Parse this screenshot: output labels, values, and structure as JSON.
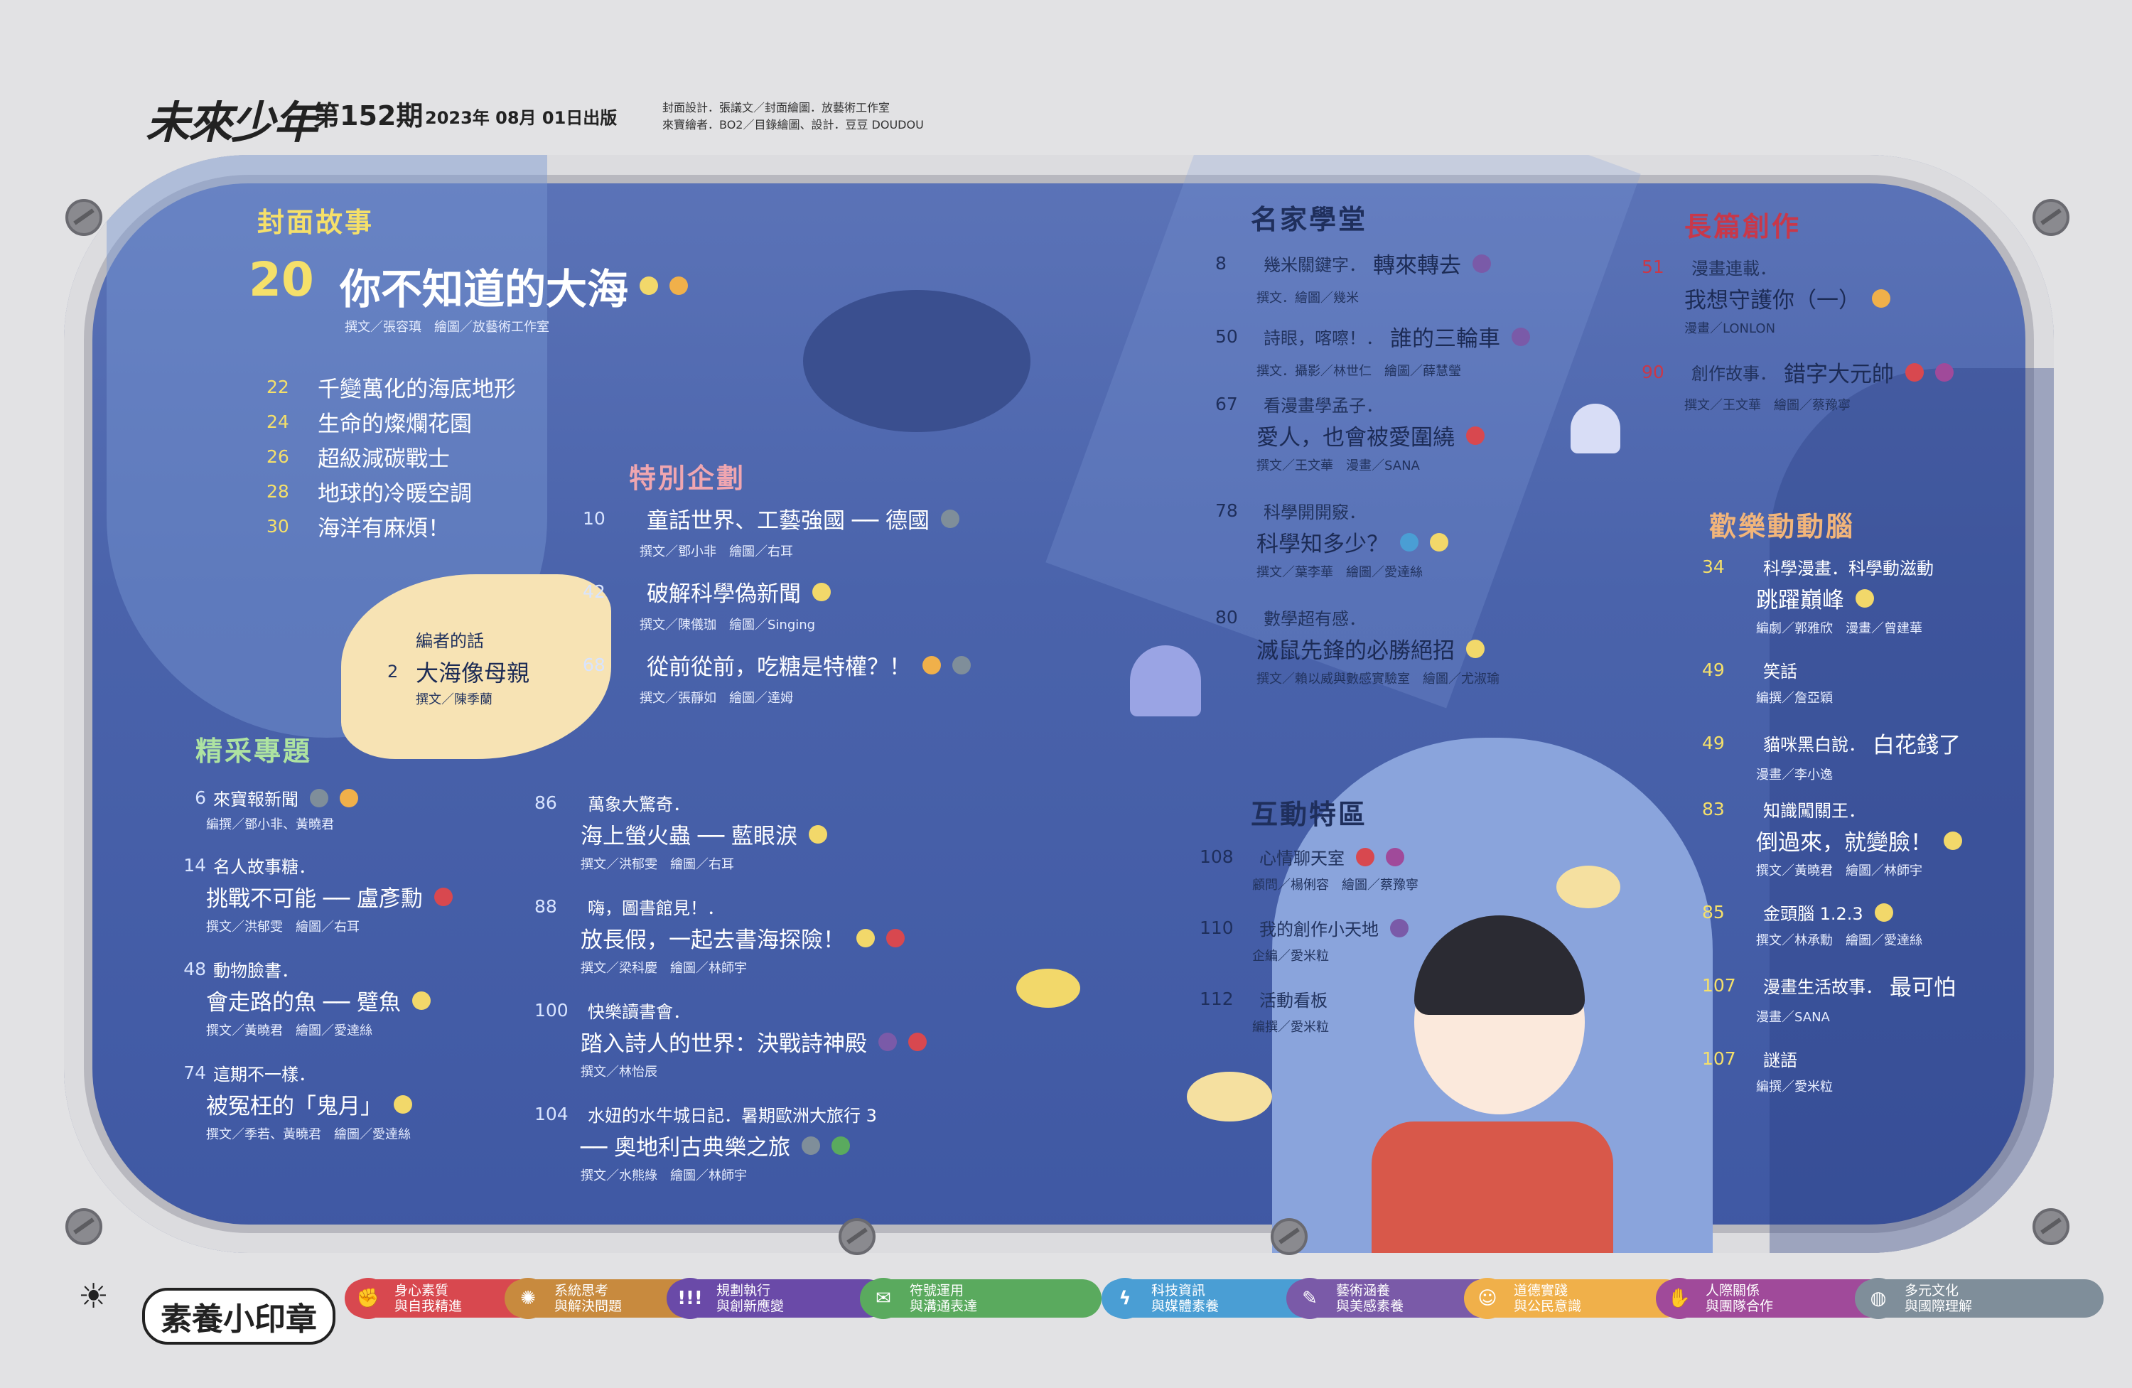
{
  "header": {
    "logo": "未來少年",
    "issue": "第152期",
    "date": "2023年 08月 01日出版",
    "credit_line1": "封面設計．張議文／封面繪圖．放藝術工作室",
    "credit_line2": "來寶繪者．BO2／目錄繪圖、設計．豆豆 DOUDOU"
  },
  "cover_story": {
    "title": "封面故事",
    "main_num": "20",
    "main_title": "你不知道的大海",
    "main_credit": "撰文／張容瑱　繪圖／放藝術工作室",
    "items": [
      {
        "num": "22",
        "title": "千變萬化的海底地形"
      },
      {
        "num": "24",
        "title": "生命的燦爛花園"
      },
      {
        "num": "26",
        "title": "超級減碳戰士"
      },
      {
        "num": "28",
        "title": "地球的冷暖空調"
      },
      {
        "num": "30",
        "title": "海洋有麻煩！"
      }
    ]
  },
  "editor": {
    "label": "編者的話",
    "num": "2",
    "title": "大海像母親",
    "credit": "撰文／陳季蘭"
  },
  "special": {
    "title": "特別企劃",
    "items": [
      {
        "num": "10",
        "title": "童話世界、工藝強國 ── 德國",
        "credit": "撰文／鄧小非　繪圖／右耳"
      },
      {
        "num": "42",
        "title": "破解科學偽新聞",
        "credit": "撰文／陳儀珈　繪圖／Singing"
      },
      {
        "num": "68",
        "title": "從前從前，吃糖是特權？！",
        "credit": "撰文／張靜如　繪圖／達姆"
      }
    ]
  },
  "featured": {
    "title": "精采專題",
    "items": [
      {
        "num": "6",
        "cat": "來寶報新聞",
        "title": "",
        "credit": "編撰／鄧小非、黃曉君"
      },
      {
        "num": "14",
        "cat": "名人故事糖．",
        "title": "挑戰不可能 ── 盧彥勳",
        "credit": "撰文／洪郁雯　繪圖／右耳"
      },
      {
        "num": "48",
        "cat": "動物臉書．",
        "title": "會走路的魚 ── 躄魚",
        "credit": "撰文／黃曉君　繪圖／愛達絲"
      },
      {
        "num": "74",
        "cat": "這期不一樣．",
        "title": "被冤枉的「鬼月」",
        "credit": "撰文／季若、黃曉君　繪圖／愛達絲"
      }
    ]
  },
  "middle": {
    "items": [
      {
        "num": "86",
        "cat": "萬象大驚奇．",
        "title": "海上螢火蟲 ── 藍眼淚",
        "credit": "撰文／洪郁雯　繪圖／右耳"
      },
      {
        "num": "88",
        "cat": "嗨，圖書館見！．",
        "title": "放長假，一起去書海探險！",
        "credit": "撰文／梁科慶　繪圖／林師宇"
      },
      {
        "num": "100",
        "cat": "快樂讀書會．",
        "title": "踏入詩人的世界：決戰詩神殿",
        "credit": "撰文／林怡辰"
      },
      {
        "num": "104",
        "cat": "水妞的水牛城日記．暑期歐洲大旅行 3",
        "title": "── 奧地利古典樂之旅",
        "credit": "撰文／水熊綠　繪圖／林師宇"
      }
    ]
  },
  "famous": {
    "title": "名家學堂",
    "items": [
      {
        "num": "8",
        "cat": "幾米關鍵字．",
        "title": "轉來轉去",
        "credit": "撰文．繪圖／幾米"
      },
      {
        "num": "50",
        "cat": "詩眼，喀嚓！．",
        "title": "誰的三輪車",
        "credit": "撰文．攝影／林世仁　繪圖／薛慧瑩"
      },
      {
        "num": "67",
        "cat": "看漫畫學孟子．",
        "title": "愛人，也會被愛圍繞",
        "credit": "撰文／王文華　漫畫／SANA"
      },
      {
        "num": "78",
        "cat": "科學開開竅．",
        "title": "科學知多少？",
        "credit": "撰文／葉李華　繪圖／愛達絲"
      },
      {
        "num": "80",
        "cat": "數學超有感．",
        "title": "滅鼠先鋒的必勝絕招",
        "credit": "撰文／賴以威與數感實驗室　繪圖／尤淑瑜"
      }
    ]
  },
  "interactive": {
    "title": "互動特區",
    "items": [
      {
        "num": "108",
        "title": "心情聊天室",
        "credit": "顧問／楊俐容　繪圖／蔡豫寧"
      },
      {
        "num": "110",
        "title": "我的創作小天地",
        "credit": "企編／愛米粒"
      },
      {
        "num": "112",
        "title": "活動看板",
        "credit": "編撰／愛米粒"
      }
    ]
  },
  "longform": {
    "title": "長篇創作",
    "items": [
      {
        "num": "51",
        "cat": "漫畫連載．",
        "title": "我想守護你（一）",
        "credit": "漫畫／LONLON"
      },
      {
        "num": "90",
        "cat": "創作故事．",
        "title": "錯字大元帥",
        "credit": "撰文／王文華　繪圖／蔡豫寧"
      }
    ]
  },
  "fun": {
    "title": "歡樂動動腦",
    "items": [
      {
        "num": "34",
        "cat": "科學漫畫．科學動滋動",
        "title": "跳躍巔峰",
        "credit": "編劇／郭雅欣　漫畫／曾建華"
      },
      {
        "num": "49",
        "cat": "笑話",
        "title": "",
        "credit": "編撰／詹亞穎"
      },
      {
        "num": "49",
        "cat": "貓咪黑白說．",
        "title": "白花錢了",
        "credit": "漫畫／李小逸"
      },
      {
        "num": "83",
        "cat": "知識闖關王．",
        "title": "倒過來，就變臉！",
        "credit": "撰文／黃曉君　繪圖／林師宇"
      },
      {
        "num": "85",
        "cat": "金頭腦 1.2.3",
        "title": "",
        "credit": "撰文／林承勳　繪圖／愛達絲"
      },
      {
        "num": "107",
        "cat": "漫畫生活故事．",
        "title": "最可怕",
        "credit": "漫畫／SANA"
      },
      {
        "num": "107",
        "cat": "謎語",
        "title": "",
        "credit": "編撰／愛米粒"
      }
    ]
  },
  "legend": {
    "title": "素養小印章",
    "items": [
      {
        "l1": "身心素質",
        "l2": "與自我精進",
        "color": "#d8484f",
        "glyph": "✊"
      },
      {
        "l1": "系統思考",
        "l2": "與解決問題",
        "color": "#c88a3e",
        "glyph": "✺"
      },
      {
        "l1": "規劃執行",
        "l2": "與創新應變",
        "color": "#6a4aa8",
        "glyph": "!!!"
      },
      {
        "l1": "符號運用",
        "l2": "與溝通表達",
        "color": "#5aaa5e",
        "glyph": "✉"
      },
      {
        "l1": "科技資訊",
        "l2": "與媒體素養",
        "color": "#4a9ed4",
        "glyph": "ϟ"
      },
      {
        "l1": "藝術涵養",
        "l2": "與美感素養",
        "color": "#7a5aa8",
        "glyph": "✎"
      },
      {
        "l1": "道德實踐",
        "l2": "與公民意識",
        "color": "#f0b04a",
        "glyph": "☺"
      },
      {
        "l1": "人際關係",
        "l2": "與團隊合作",
        "color": "#a04a9a",
        "glyph": "✋"
      },
      {
        "l1": "多元文化",
        "l2": "與國際理解",
        "color": "#7f8e9a",
        "glyph": "◍"
      }
    ]
  }
}
